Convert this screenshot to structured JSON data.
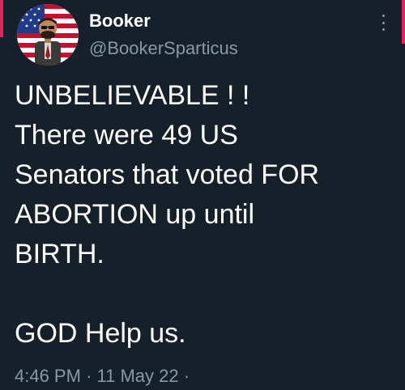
{
  "theme": {
    "background": "#15202b",
    "text_primary": "#ffffff",
    "text_secondary": "#8899a6",
    "accent_bar": "#e0245e"
  },
  "author": {
    "display_name": "Booker",
    "handle": "@BookerSparticus",
    "avatar_icon": "profile-avatar-flag-background"
  },
  "tweet": {
    "lines": [
      "UNBELIEVABLE ! !",
      "There were 49 US",
      "Senators that voted FOR",
      "ABORTION up until",
      "BIRTH.",
      "",
      "GOD Help us."
    ],
    "time": "4:46 PM",
    "separator": "·",
    "date": "11 May 22",
    "trailing_separator": "·"
  },
  "menu": {
    "icon": "more-vertical-icon"
  }
}
